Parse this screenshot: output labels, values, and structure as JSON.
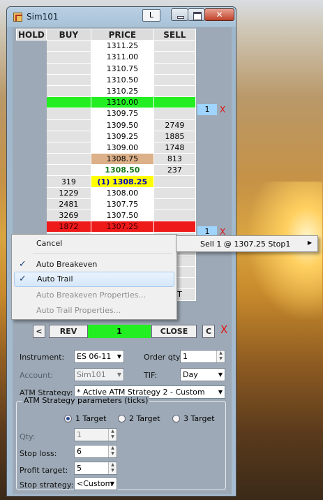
{
  "window": {
    "title": "Sim101",
    "l_button": "L"
  },
  "ladder": {
    "headers": {
      "hold": "HOLD",
      "buy": "BUY",
      "price": "PRICE",
      "sell": "SELL"
    },
    "rows": [
      {
        "buy": "",
        "price": "1311.25",
        "sell": ""
      },
      {
        "buy": "",
        "price": "1311.00",
        "sell": ""
      },
      {
        "buy": "",
        "price": "1310.75",
        "sell": ""
      },
      {
        "buy": "",
        "price": "1310.50",
        "sell": ""
      },
      {
        "buy": "",
        "price": "1310.25",
        "sell": ""
      },
      {
        "buy": "",
        "price": "1310.00",
        "sell": ""
      },
      {
        "buy": "",
        "price": "1309.75",
        "sell": ""
      },
      {
        "buy": "",
        "price": "1309.50",
        "sell": "2749"
      },
      {
        "buy": "",
        "price": "1309.25",
        "sell": "1885"
      },
      {
        "buy": "",
        "price": "1309.00",
        "sell": "1748"
      },
      {
        "buy": "",
        "price": "1308.75",
        "sell": "813"
      },
      {
        "buy": "",
        "price": "1308.50",
        "sell": "237"
      },
      {
        "buy": "319",
        "price": "(1) 1308.25",
        "sell": ""
      },
      {
        "buy": "1229",
        "price": "1308.00",
        "sell": ""
      },
      {
        "buy": "2481",
        "price": "1307.75",
        "sell": ""
      },
      {
        "buy": "3269",
        "price": "1307.50",
        "sell": ""
      },
      {
        "buy": "1872",
        "price": "1307.25",
        "sell": ""
      },
      {
        "buy": "",
        "price": "",
        "sell": ""
      },
      {
        "buy": "",
        "price": "",
        "sell": ""
      },
      {
        "buy": "",
        "price": "",
        "sell": ""
      },
      {
        "buy": "",
        "price": "",
        "sell": ""
      },
      {
        "buy": "",
        "price": "",
        "sell": ""
      },
      {
        "buy": "",
        "price": "",
        "sell": "KET"
      }
    ],
    "stop_green_qty": "1",
    "stop_red_qty": "1",
    "cancel_x": "X"
  },
  "actions": {
    "prev": "<",
    "rev": "REV",
    "qty": "1",
    "close": "CLOSE",
    "c": "C",
    "x": "X"
  },
  "form": {
    "instrument_label": "Instrument:",
    "instrument_value": "ES 06-11",
    "order_qty_label": "Order qty:",
    "order_qty_value": "1",
    "account_label": "Account:",
    "account_value": "Sim101",
    "tif_label": "TIF:",
    "tif_value": "Day",
    "atm_label": "ATM Strategy:",
    "atm_value": "* Active ATM Strategy 2 - Custom",
    "params_title": "ATM Strategy parameters (ticks)",
    "target1": "1 Target",
    "target2": "2 Target",
    "target3": "3 Target",
    "qty_label": "Qty:",
    "qty_value": "1",
    "stop_loss_label": "Stop loss:",
    "stop_loss_value": "6",
    "profit_target_label": "Profit target:",
    "profit_target_value": "5",
    "stop_strategy_label": "Stop strategy:",
    "stop_strategy_value": "<Custom"
  },
  "context_menu": {
    "cancel": "Cancel",
    "auto_breakeven": "Auto Breakeven",
    "auto_trail": "Auto Trail",
    "auto_breakeven_props": "Auto Breakeven Properties...",
    "auto_trail_props": "Auto Trail Properties..."
  },
  "submenu": {
    "label": "Sell 1 @ 1307.25 Stop1"
  }
}
